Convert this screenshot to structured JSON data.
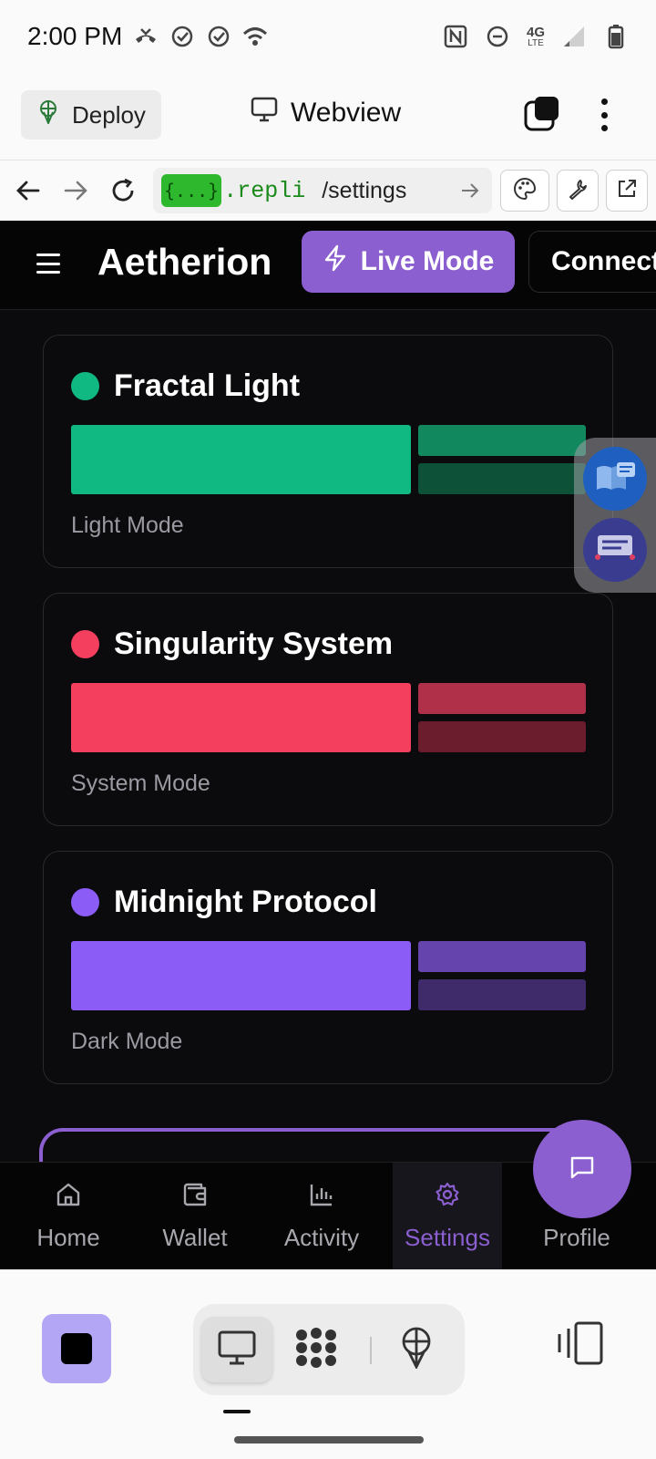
{
  "status_bar": {
    "time": "2:00 PM",
    "network": "4G",
    "network_sub": "LTE"
  },
  "app_header": {
    "deploy_label": "Deploy",
    "title": "Webview"
  },
  "url_bar": {
    "badge": "{...}",
    "host": ".repli",
    "path": "/settings"
  },
  "web_header": {
    "brand": "Aetherion",
    "live_label": "Live Mode",
    "connect_label": "Connect"
  },
  "themes": [
    {
      "name": "Fractal Light",
      "mode": "Light Mode",
      "color": "#10b981",
      "shade_a": "#12885f",
      "shade_b": "#0d5238"
    },
    {
      "name": "Singularity System",
      "mode": "System Mode",
      "color": "#f43f5e",
      "shade_a": "#b0304a",
      "shade_b": "#6b1d2e"
    },
    {
      "name": "Midnight Protocol",
      "mode": "Dark Mode",
      "color": "#8b5cf6",
      "shade_a": "#6544ad",
      "shade_b": "#3f2a6a"
    }
  ],
  "bottom_nav": {
    "items": [
      {
        "label": "Home",
        "icon": "home-icon"
      },
      {
        "label": "Wallet",
        "icon": "wallet-icon"
      },
      {
        "label": "Activity",
        "icon": "bar-chart-icon"
      },
      {
        "label": "Settings",
        "icon": "gear-icon"
      },
      {
        "label": "Profile",
        "icon": "user-icon"
      }
    ],
    "active": "Settings"
  },
  "colors": {
    "accent": "#8b5fcf",
    "background": "#0b0b0d"
  }
}
